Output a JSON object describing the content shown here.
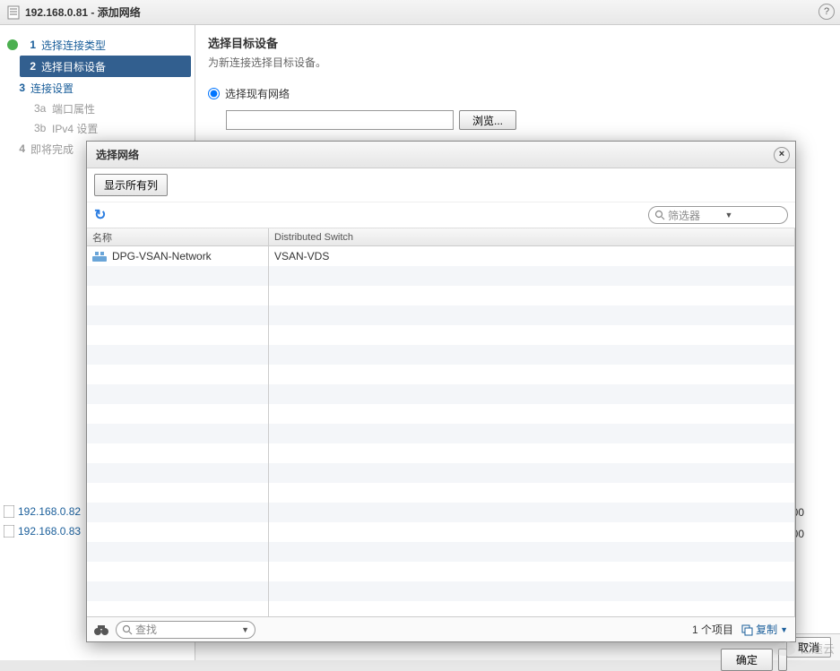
{
  "window": {
    "host": "192.168.0.81",
    "separator": " - ",
    "title": "添加网络",
    "help": "?"
  },
  "wizard": {
    "steps": [
      {
        "num": "1",
        "label": "选择连接类型",
        "state": "completed"
      },
      {
        "num": "2",
        "label": "选择目标设备",
        "state": "active"
      },
      {
        "num": "3",
        "label": "连接设置",
        "state": "pending"
      },
      {
        "num": "4",
        "label": "即将完成",
        "state": "muted"
      }
    ],
    "substeps": [
      {
        "num": "3a",
        "label": "端口属性"
      },
      {
        "num": "3b",
        "label": "IPv4 设置"
      }
    ]
  },
  "panel": {
    "heading": "选择目标设备",
    "sub": "为新连接选择目标设备。",
    "radio_label": "选择现有网络",
    "input_value": "",
    "browse": "浏览..."
  },
  "footer": {
    "cancel": "取消"
  },
  "bg_hosts": [
    "192.168.0.82",
    "192.168.0.83"
  ],
  "bg_tail": "00",
  "modal": {
    "title": "选择网络",
    "close": "×",
    "show_all": "显示所有列",
    "filter_placeholder": "筛选器",
    "columns": {
      "name": "名称",
      "ds": "Distributed Switch"
    },
    "rows": [
      {
        "name": "DPG-VSAN-Network",
        "ds": "VSAN-VDS"
      }
    ],
    "search_placeholder": "查找",
    "count": "1 个项目",
    "copy": "复制",
    "ok": "确定"
  },
  "watermark": "亿速云"
}
